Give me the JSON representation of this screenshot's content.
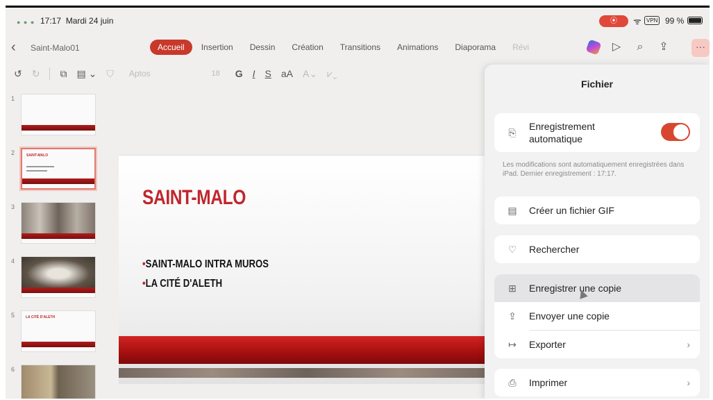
{
  "status": {
    "time": "17:17",
    "date": "Mardi 24 juin",
    "vpn": "VPN",
    "battery": "99 %"
  },
  "nav": {
    "doc_name": "Saint-Malo01",
    "tabs": [
      {
        "label": "Accueil"
      },
      {
        "label": "Insertion"
      },
      {
        "label": "Dessin"
      },
      {
        "label": "Création"
      },
      {
        "label": "Transitions"
      },
      {
        "label": "Animations"
      },
      {
        "label": "Diaporama"
      },
      {
        "label": "Révi"
      }
    ],
    "more": "···"
  },
  "toolbar": {
    "font": "Aptos",
    "size": "18",
    "bold": "G",
    "italic": "I",
    "strike": "S",
    "case": "aA"
  },
  "thumbs": [
    {
      "num": "1"
    },
    {
      "num": "2",
      "title": "SAINT-MALO"
    },
    {
      "num": "3"
    },
    {
      "num": "4"
    },
    {
      "num": "5",
      "title": "LA CITÉ D'ALETH"
    },
    {
      "num": "6"
    }
  ],
  "slide": {
    "title": "SAINT-MALO",
    "bullets": [
      "SAINT-MALO INTRA MUROS",
      "LA CITÉ D'ALETH"
    ]
  },
  "panel": {
    "title": "Fichier",
    "autosave_label": "Enregistrement automatique",
    "autosave_on": true,
    "note": "Les modifications sont automatiquement enregistrées dans iPad. Dernier enregistrement : 17:17.",
    "gif": "Créer un fichier GIF",
    "search": "Rechercher",
    "save_copy": "Enregistrer une copie",
    "send_copy": "Envoyer une copie",
    "export": "Exporter",
    "print": "Imprimer"
  },
  "colors": {
    "accent": "#c8392b",
    "toggle": "#d7472f",
    "slide_red": "#c0262d"
  }
}
